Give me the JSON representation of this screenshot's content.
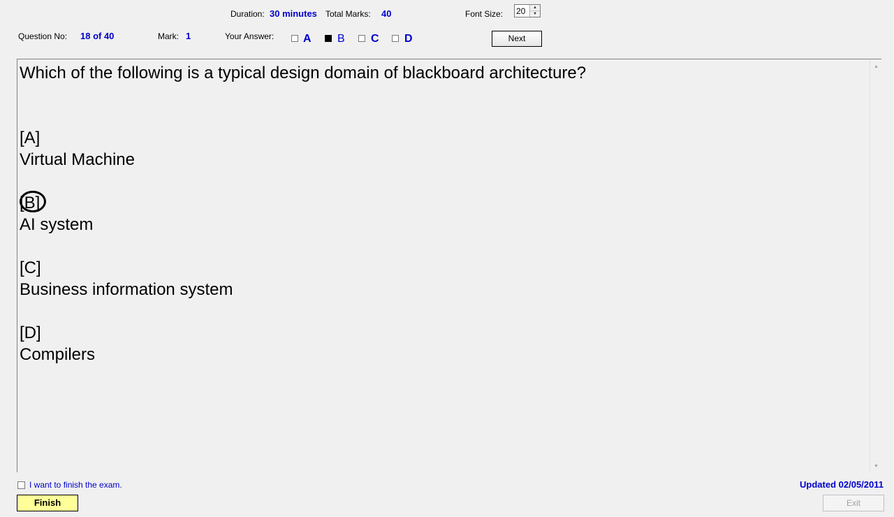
{
  "header": {
    "duration_label": "Duration:",
    "duration_value": "30 minutes",
    "total_marks_label": "Total Marks:",
    "total_marks_value": "40",
    "font_size_label": "Font Size:",
    "font_size_value": "20",
    "question_no_label": "Question No:",
    "question_no_value": "18 of 40",
    "mark_label": "Mark:",
    "mark_value": "1",
    "your_answer_label": "Your Answer:",
    "answers": [
      {
        "letter": "A",
        "checked": false
      },
      {
        "letter": "B",
        "checked": true
      },
      {
        "letter": "C",
        "checked": false
      },
      {
        "letter": "D",
        "checked": false
      }
    ],
    "next_label": "Next"
  },
  "question": {
    "text": "Which of the following is a typical design domain of blackboard architecture?",
    "options": [
      {
        "tag": "[A]",
        "text": "Virtual Machine"
      },
      {
        "tag": "[B]",
        "text": "AI system"
      },
      {
        "tag": "[C]",
        "text": "Business information system"
      },
      {
        "tag": "[D]",
        "text": "Compilers"
      }
    ],
    "highlighted_option": "B"
  },
  "footer": {
    "finish_checkbox_label": "I want to finish the exam.",
    "finish_checked": false,
    "finish_button": "Finish",
    "updated_text": "Updated 02/05/2011",
    "exit_button": "Exit"
  },
  "colors": {
    "value_blue": "#0000cc",
    "finish_button_bg": "#ffff99",
    "background": "#f0f0f0"
  }
}
